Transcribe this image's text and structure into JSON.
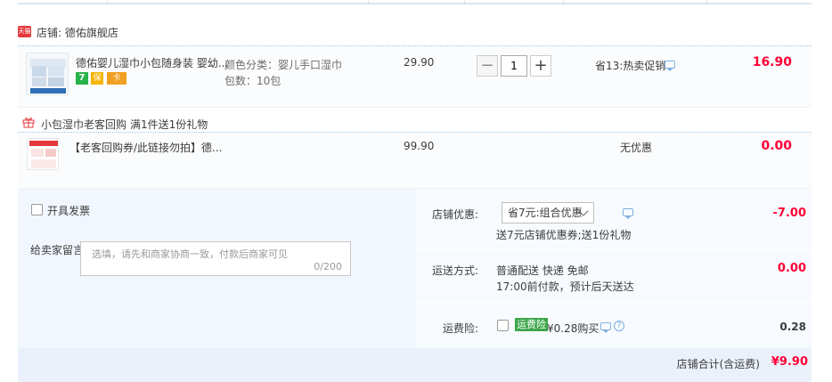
{
  "store": {
    "tag": "天猫",
    "name": "店铺: 德佑旗舰店"
  },
  "items": [
    {
      "title": "德佑婴儿湿巾小包随身装 婴幼...",
      "attr1": "颜色分类：婴儿手口湿巾",
      "attr2": "包数：10包",
      "price": "29.90",
      "quantity": "1",
      "qty_minus": "−",
      "qty_plus": "+",
      "promo": "省13:热卖促销",
      "subtotal": "16.90",
      "badges": [
        "7",
        "保",
        "卡"
      ]
    },
    {
      "title": "【老客回购券/此链接勿拍】德...",
      "price": "99.90",
      "promo": "无优惠",
      "subtotal": "0.00"
    }
  ],
  "gift": {
    "title": "小包湿巾老客回购",
    "rule": "满1件送1份礼物"
  },
  "invoice": {
    "label": "开具发票"
  },
  "message": {
    "label": "给卖家留言:",
    "placeholder": "选填，请先和商家协商一致，付款后商家可见",
    "counter": "0/200"
  },
  "store_discount": {
    "label": "店铺优惠:",
    "selected": "省7元:组合优惠",
    "note": "送7元店铺优惠券;送1份礼物",
    "value": "-7.00"
  },
  "shipping": {
    "label": "运送方式:",
    "method": "普通配送 快递 免邮",
    "eta": "17:00前付款，预计后天送达",
    "value": "0.00"
  },
  "insurance": {
    "label": "运费险:",
    "badge": "运费险",
    "price": "¥0.28购买",
    "value": "0.28"
  },
  "total": {
    "label": "店铺合计(含运费)",
    "value": "¥9.90"
  },
  "colors": {
    "accent_red": "#ff0036",
    "tmall_red": "#e4393c",
    "panel_bg": "#f2f7ff",
    "insurance_green": "#3ca64a"
  }
}
